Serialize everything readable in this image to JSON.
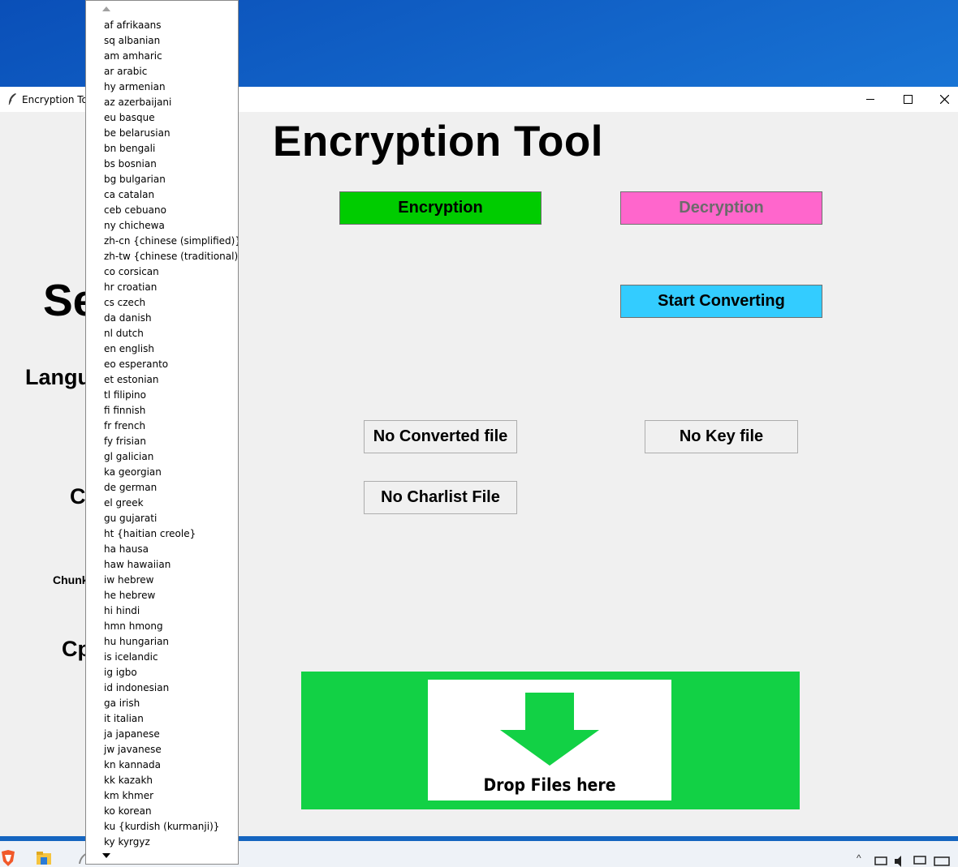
{
  "window": {
    "title": "Encryption Too"
  },
  "app": {
    "title": "Encryption Tool",
    "encryption_button": "Encryption",
    "decryption_button": "Decryption",
    "start_button": "Start Converting",
    "converted_file_button": "No Converted file",
    "key_file_button": "No Key file",
    "charlist_file_button": "No Charlist File",
    "drop_label": "Drop Files here"
  },
  "side_labels": {
    "se": "Se",
    "lang": "Langu",
    "c": "C",
    "chunk": "Chunk",
    "cp": "Cp"
  },
  "colors": {
    "encryption": "#00cc00",
    "decryption": "#ff66cc",
    "start": "#33ccff",
    "drop_zone": "#12d145"
  },
  "language_dropdown": {
    "items": [
      "af afrikaans",
      "sq albanian",
      "am amharic",
      "ar arabic",
      "hy armenian",
      "az azerbaijani",
      "eu basque",
      "be belarusian",
      "bn bengali",
      "bs bosnian",
      "bg bulgarian",
      "ca catalan",
      "ceb cebuano",
      "ny chichewa",
      "zh-cn {chinese (simplified)}",
      "zh-tw {chinese (traditional)}",
      "co corsican",
      "hr croatian",
      "cs czech",
      "da danish",
      "nl dutch",
      "en english",
      "eo esperanto",
      "et estonian",
      "tl filipino",
      "fi finnish",
      "fr french",
      "fy frisian",
      "gl galician",
      "ka georgian",
      "de german",
      "el greek",
      "gu gujarati",
      "ht {haitian creole}",
      "ha hausa",
      "haw hawaiian",
      "iw hebrew",
      "he hebrew",
      "hi hindi",
      "hmn hmong",
      "hu hungarian",
      "is icelandic",
      "ig igbo",
      "id indonesian",
      "ga irish",
      "it italian",
      "ja japanese",
      "jw javanese",
      "kn kannada",
      "kk kazakh",
      "km khmer",
      "ko korean",
      "ku {kurdish (kurmanji)}",
      "ky kyrgyz"
    ]
  }
}
